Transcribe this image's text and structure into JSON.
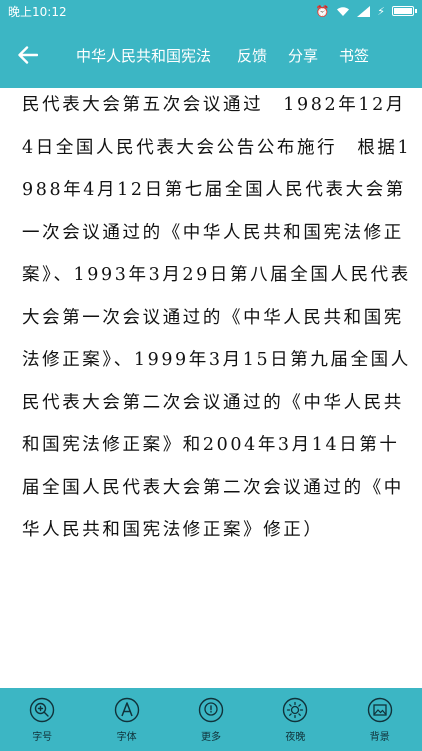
{
  "status": {
    "time": "晚上10:12"
  },
  "toolbar": {
    "title": "中华人民共和国宪法",
    "feedback": "反馈",
    "share": "分享",
    "bookmark": "书签"
  },
  "article": {
    "text": "民代表大会第五次会议通过　1982年12月4日全国人民代表大会公告公布施行　根据1988年4月12日第七届全国人民代表大会第一次会议通过的《中华人民共和国宪法修正案》、1993年3月29日第八届全国人民代表大会第一次会议通过的《中华人民共和国宪法修正案》、1999年3月15日第九届全国人民代表大会第二次会议通过的《中华人民共和国宪法修正案》和2004年3月14日第十届全国人民代表大会第二次会议通过的《中华人民共和国宪法修正案》修正）"
  },
  "bottom": {
    "font_size": "字号",
    "font": "字体",
    "more": "更多",
    "night": "夜晚",
    "background": "背景"
  },
  "colors": {
    "accent": "#3cb6c4",
    "icon": "#10323a"
  }
}
